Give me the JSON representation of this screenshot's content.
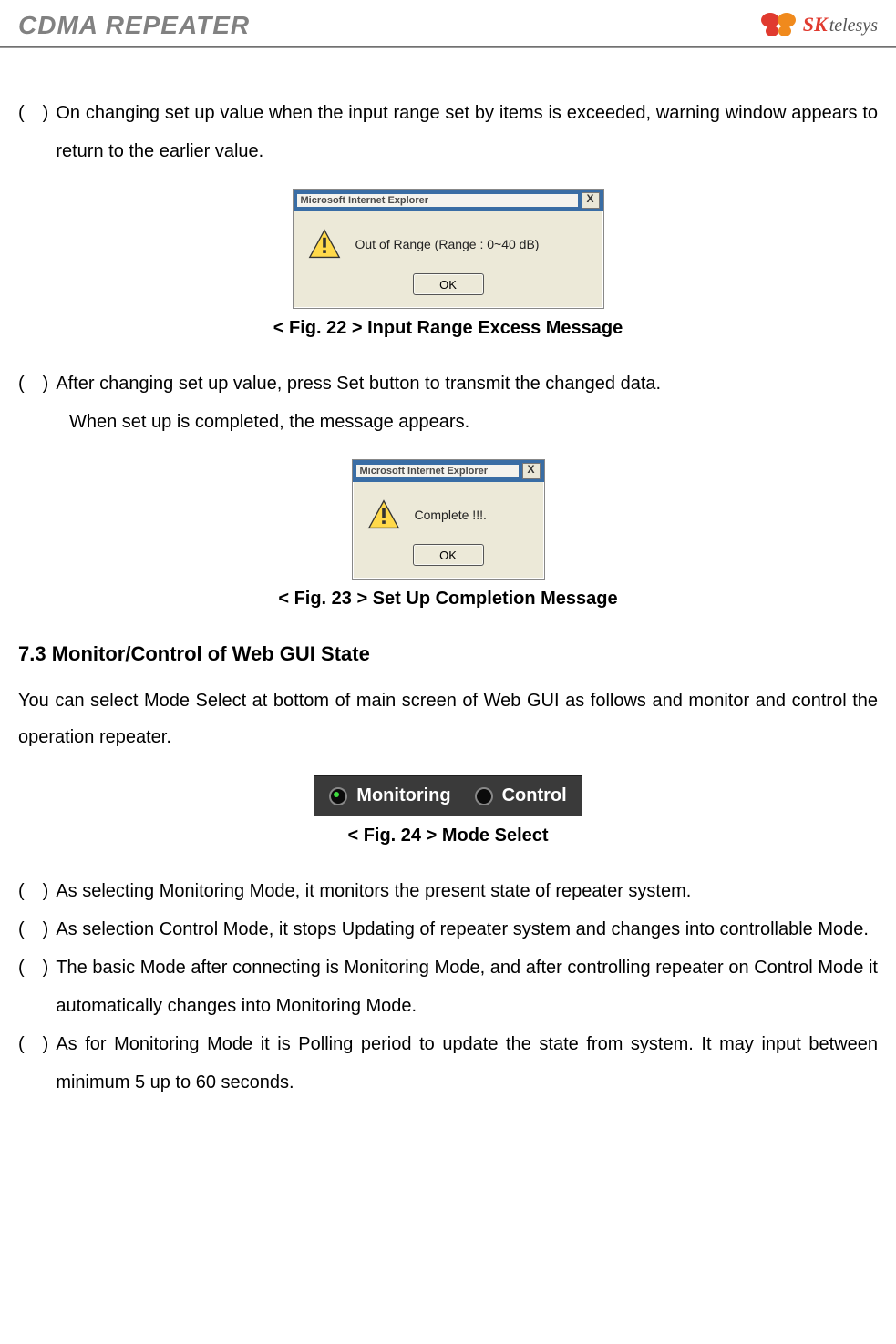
{
  "header": {
    "title": "CDMA REPEATER",
    "brand_left": "SK",
    "brand_right": "telesys"
  },
  "intro1": {
    "bullet": "(　)",
    "text": "On changing set up value when the input range set by items is exceeded, warning window appears to return to the earlier value."
  },
  "dialog1": {
    "window_label": "Microsoft Internet Explorer",
    "close": "X",
    "message": "Out of Range (Range : 0~40 dB)",
    "ok": "OK"
  },
  "caption1": "< Fig. 22 > Input Range Excess Message",
  "intro2": {
    "bullet": "(　)",
    "line1": "After changing set up value, press Set button to transmit the changed data.",
    "line2": "When set up is completed, the message appears."
  },
  "dialog2": {
    "window_label": "Microsoft Internet Explorer",
    "close": "X",
    "message": "Complete !!!.",
    "ok": "OK"
  },
  "caption2": "< Fig. 23 > Set Up Completion Message",
  "section": {
    "heading": "7.3  Monitor/Control of Web GUI State",
    "body": "You can select Mode Select at bottom of main screen of Web GUI as follows and monitor and control the operation repeater."
  },
  "mode": {
    "monitoring": "Monitoring",
    "control": "Control"
  },
  "caption3": "< Fig. 24 > Mode Select",
  "list": {
    "b": "(　)",
    "i1": "As selecting Monitoring Mode, it monitors the present state of repeater system.",
    "i2": "As selection Control Mode, it stops Updating of repeater system and changes into controllable Mode.",
    "i3": "The basic Mode after connecting is Monitoring Mode, and after controlling repeater on Control Mode it automatically changes into Monitoring Mode.",
    "i4": "As for Monitoring Mode it is Polling period to update the state from system. It may input between minimum 5 up to 60 seconds."
  }
}
